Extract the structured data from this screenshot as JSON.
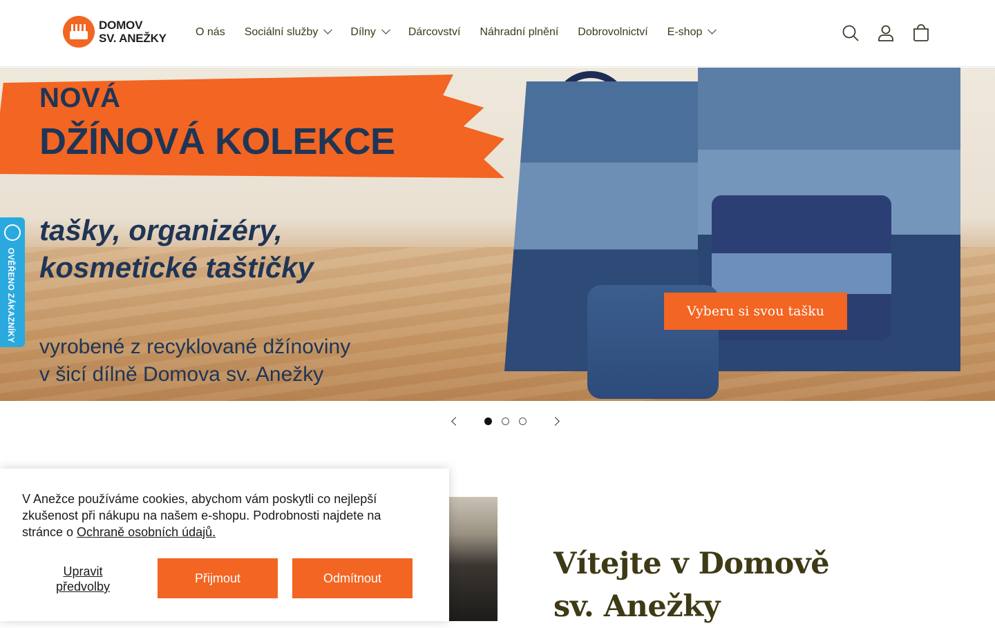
{
  "brand": {
    "line1": "DOMOV",
    "line2": "SV. ANEŽKY",
    "accent_color": "#f26522"
  },
  "nav": {
    "items": [
      {
        "label": "O nás",
        "has_dropdown": false
      },
      {
        "label": "Sociální služby",
        "has_dropdown": true
      },
      {
        "label": "Dílny",
        "has_dropdown": true
      },
      {
        "label": "Dárcovství",
        "has_dropdown": false
      },
      {
        "label": "Náhradní plnění",
        "has_dropdown": false
      },
      {
        "label": "Dobrovolnictví",
        "has_dropdown": false
      },
      {
        "label": "E-shop",
        "has_dropdown": true
      }
    ]
  },
  "header_icons": [
    "search-icon",
    "account-icon",
    "cart-icon"
  ],
  "hero": {
    "title_line1": "NOVÁ",
    "title_line2": "DŽÍNOVÁ KOLEKCE",
    "subtitle_line1": "tašky, organizéry,",
    "subtitle_line2": "kosmetické taštičky",
    "footer_line1": "vyrobené z recyklované džínoviny",
    "footer_line2": "v šicí dílně Domova sv. Anežky",
    "cta": "Vyberu si svou tašku"
  },
  "verified_badge": {
    "label": "OVĚŘENO ZÁKAZNÍKY"
  },
  "slider": {
    "slides": 3,
    "active": 1
  },
  "welcome": {
    "title": "Vítejte v Domově sv. Anežky"
  },
  "cookie": {
    "text": "V Anežce používáme cookies, abychom vám poskytli co nejlepší zkušenost při nákupu na našem e-shopu. Podrobnosti najdete na stránce o ",
    "link": "Ochraně osobních údajů.",
    "preferences": "Upravit předvolby",
    "accept": "Přijmout",
    "reject": "Odmítnout"
  }
}
